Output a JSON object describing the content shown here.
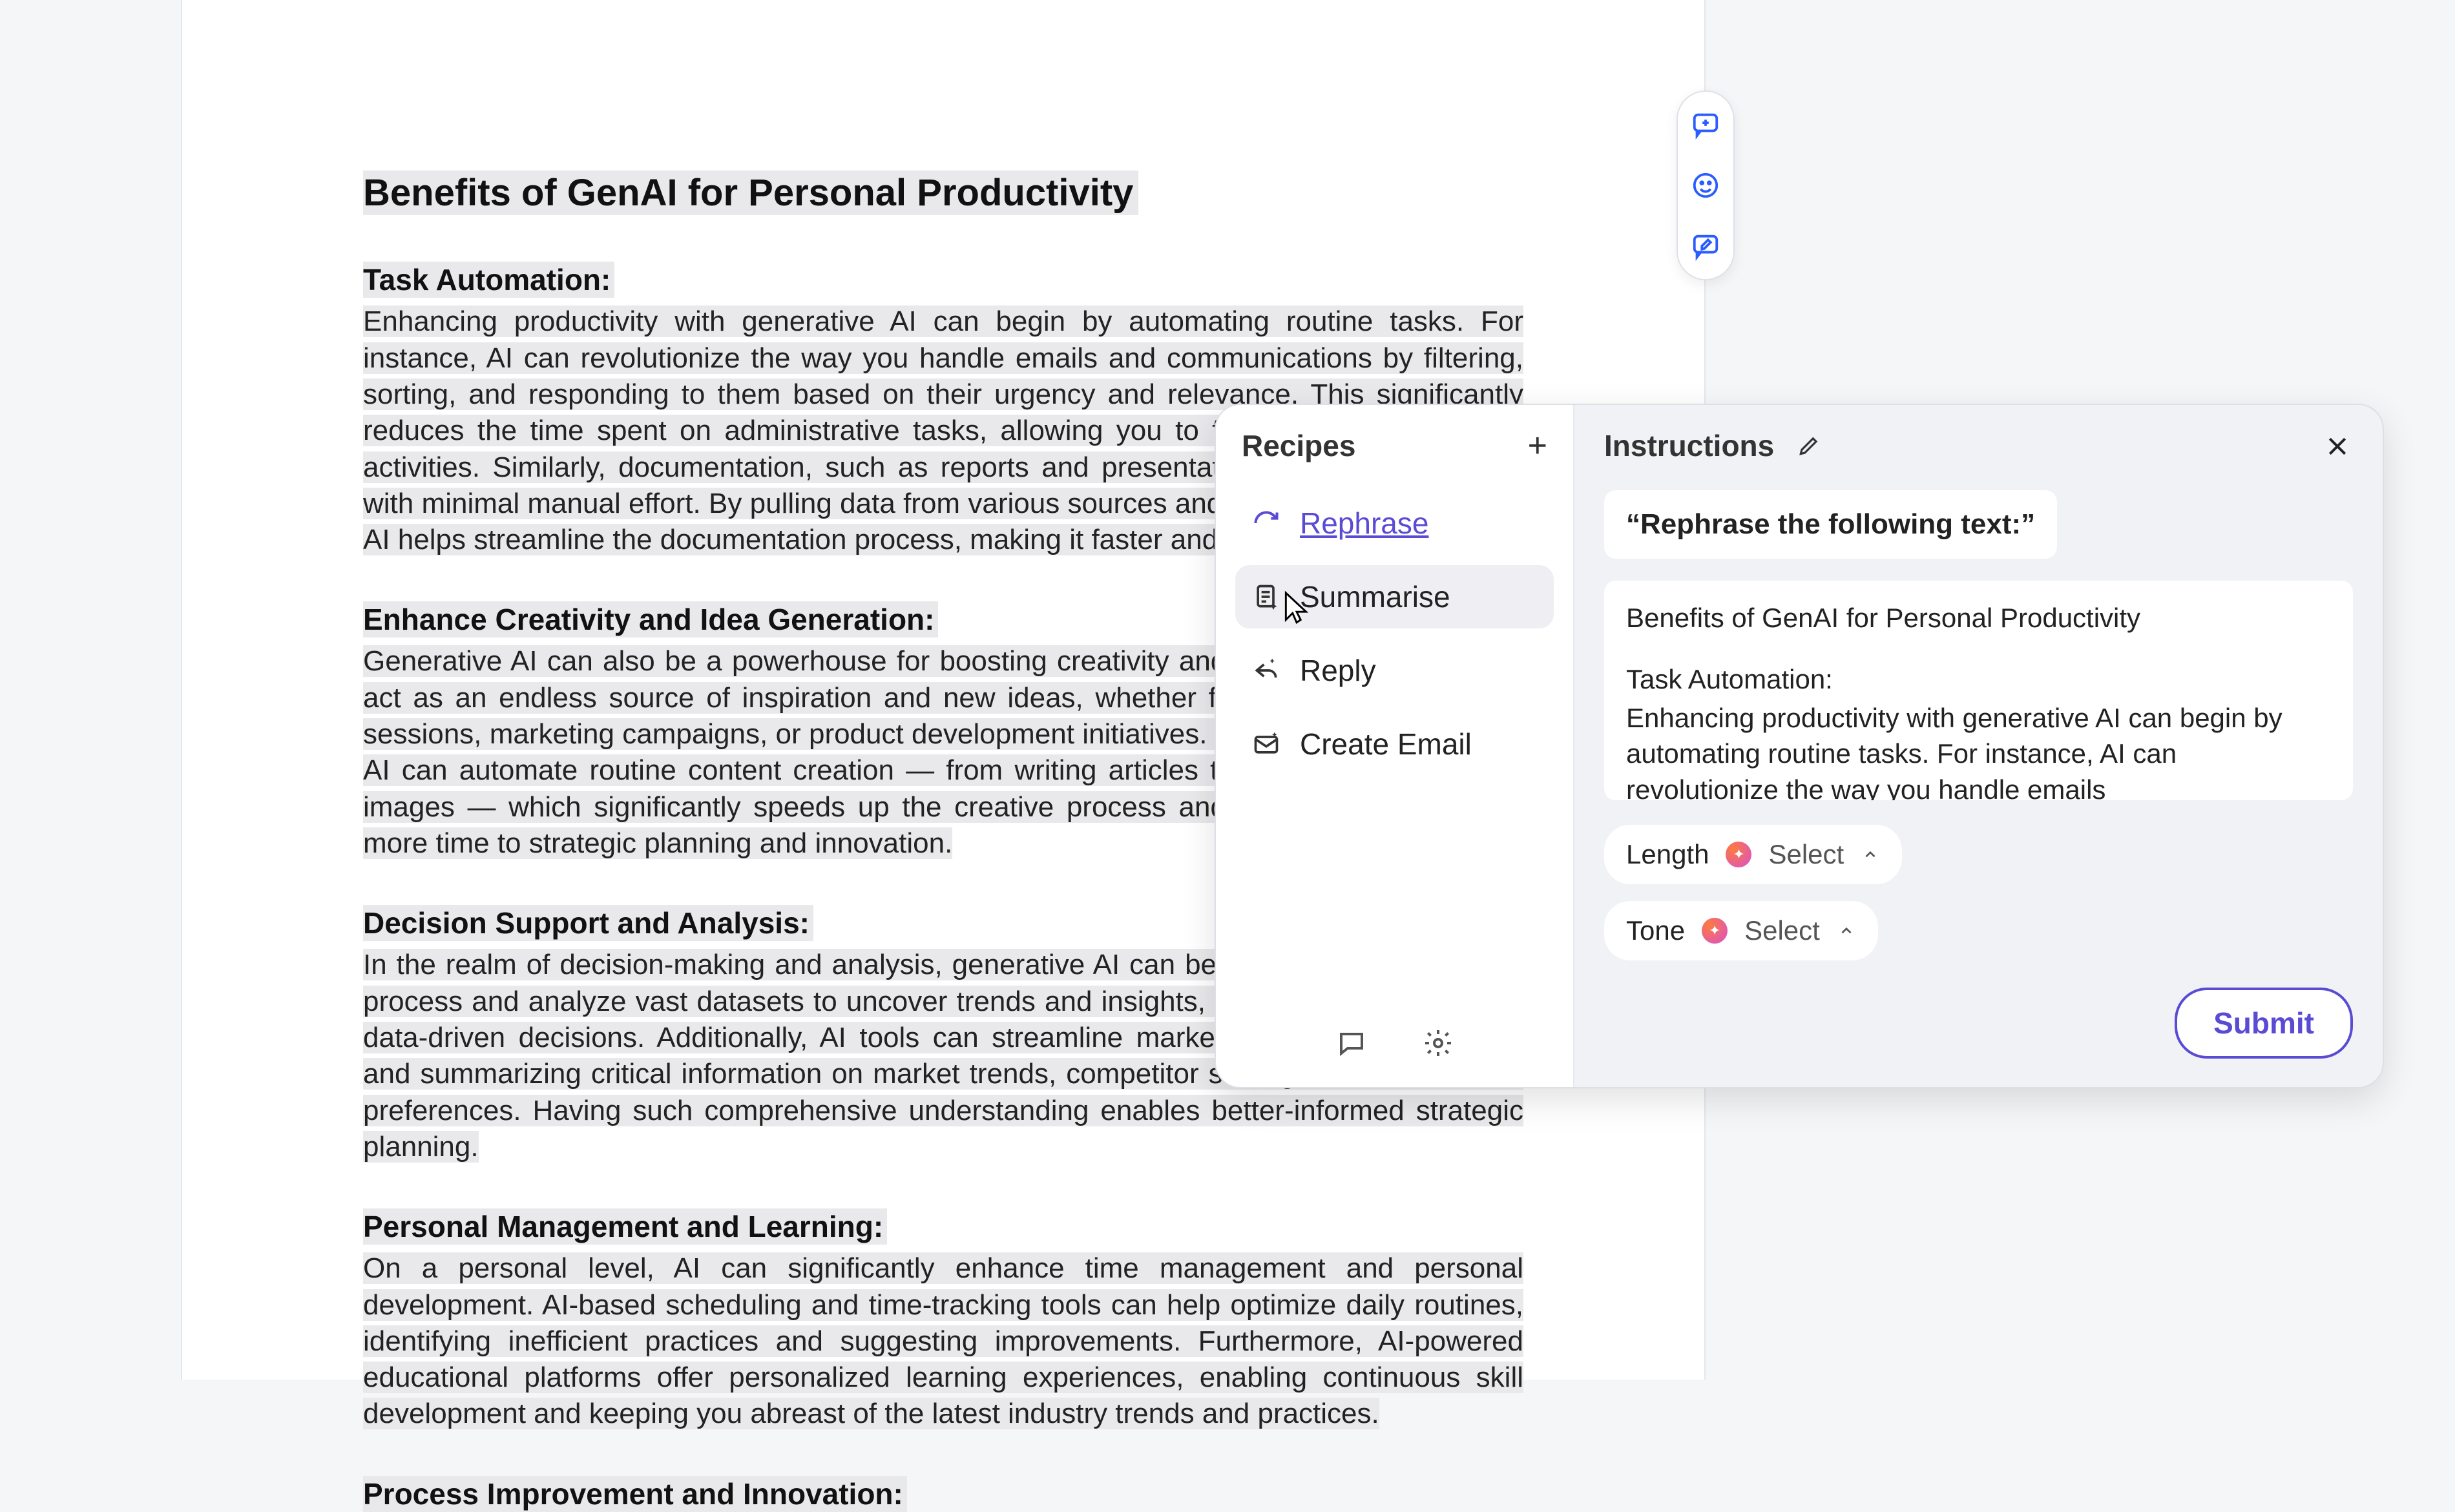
{
  "document": {
    "title": "Benefits of GenAI for Personal Productivity",
    "sections": [
      {
        "heading": "Task Automation:",
        "body": "Enhancing productivity with generative AI can begin by automating routine tasks. For instance, AI can revolutionize the way you handle emails and communications by filtering, sorting, and responding to them based on their urgency and relevance. This significantly reduces the time spent on administrative tasks, allowing you to focus on more strategic activities. Similarly, documentation, such as reports and presentations, can be generated with minimal manual effort. By pulling data from various sources and organizing it effectively, AI helps streamline the documentation process, making it faster and more efficient."
      },
      {
        "heading": "Enhance Creativity and Idea Generation:",
        "body": "Generative AI can also be a powerhouse for boosting creativity and idea generation. It can act as an endless source of inspiration and new ideas, whether for project brainstorming sessions, marketing campaigns, or product development initiatives. Beyond idea generation, AI can automate routine content creation — from writing articles to producing videos and images — which significantly speeds up the creative process and allows you to allocate more time to strategic planning and innovation."
      },
      {
        "heading": "Decision Support and Analysis:",
        "body": "In the realm of decision-making and analysis, generative AI can be a formidable ally. It can process and analyze vast datasets to uncover trends and insights, aiding in more informed, data-driven decisions. Additionally, AI tools can streamline market research by compiling and summarizing critical information on market trends, competitor strategies, and customer preferences. Having such comprehensive understanding enables better-informed strategic planning."
      },
      {
        "heading": "Personal Management and Learning:",
        "body": "On a personal level, AI can significantly enhance time management and personal development. AI-based scheduling and time-tracking tools can help optimize daily routines, identifying inefficient practices and suggesting improvements. Furthermore, AI-powered educational platforms offer personalized learning experiences, enabling continuous skill development and keeping you abreast of the latest industry trends and practices."
      },
      {
        "heading": "Process Improvement and Innovation:",
        "body": ""
      }
    ]
  },
  "side_toolbar": {
    "add_comment": "add-comment",
    "emoji": "emoji",
    "suggest": "suggest-edit"
  },
  "panel": {
    "recipes": {
      "title": "Recipes",
      "items": [
        {
          "icon": "refresh-icon",
          "label": "Rephrase",
          "state": "active"
        },
        {
          "icon": "document-sparkle-icon",
          "label": "Summarise",
          "state": "hover"
        },
        {
          "icon": "reply-sparkle-icon",
          "label": "Reply",
          "state": ""
        },
        {
          "icon": "mail-sparkle-icon",
          "label": "Create Email",
          "state": ""
        }
      ]
    },
    "instructions": {
      "title": "Instructions",
      "prompt": "“Rephrase the following text:”",
      "context_title": "Benefits of GenAI for Personal Productivity",
      "context_sub": "Task Automation:",
      "context_body": "Enhancing productivity with generative AI can begin by automating routine tasks. For instance, AI can revolutionize the way you handle emails",
      "params": [
        {
          "label": "Length",
          "value": "Select"
        },
        {
          "label": "Tone",
          "value": "Select"
        }
      ],
      "submit": "Submit"
    }
  }
}
